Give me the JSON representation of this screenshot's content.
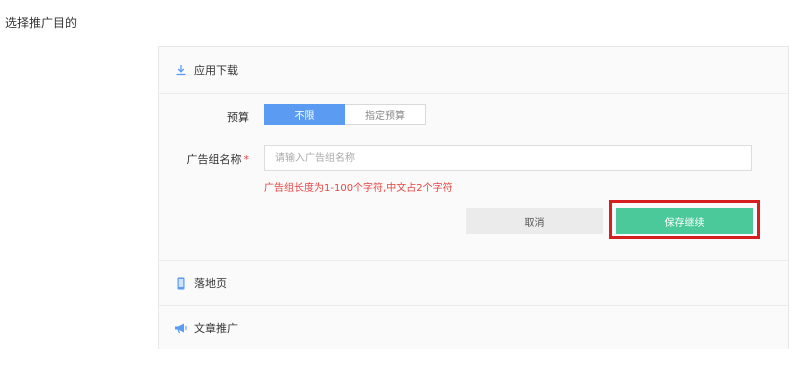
{
  "page": {
    "title": "选择推广目的"
  },
  "sections": {
    "app_download": {
      "label": "应用下载",
      "icon": "download-icon"
    },
    "landing_page": {
      "label": "落地页",
      "icon": "mobile-icon"
    },
    "article": {
      "label": "文章推广",
      "icon": "megaphone-icon"
    }
  },
  "form": {
    "budget": {
      "label": "预算",
      "options": [
        "不限",
        "指定预算"
      ],
      "selected": "不限"
    },
    "ad_group_name": {
      "label": "广告组名称",
      "required_mark": "*",
      "placeholder": "请输入广告组名称",
      "value": "",
      "hint": "广告组长度为1-100个字符,中文占2个字符"
    },
    "buttons": {
      "cancel": "取消",
      "save": "保存继续"
    }
  },
  "colors": {
    "accent_blue": "#5b9bf1",
    "save_green": "#4cc99a",
    "error_red": "#e64545",
    "highlight_red": "#d81f1f"
  }
}
